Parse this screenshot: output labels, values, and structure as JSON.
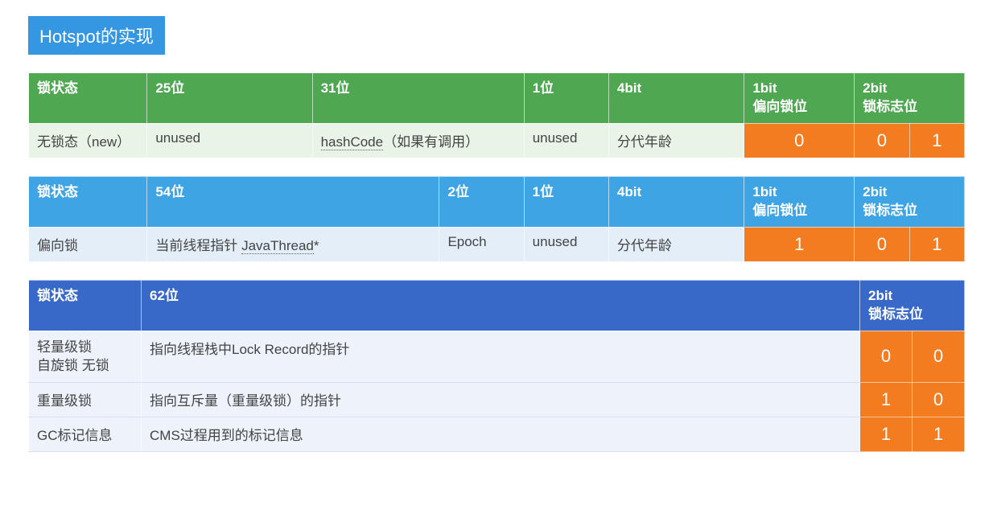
{
  "title": "Hotspot的实现",
  "table1": {
    "headers": {
      "c0": "锁状态",
      "c1": "25位",
      "c2": "31位",
      "c3": "1位",
      "c4": "4bit",
      "c5a": "1bit",
      "c5b": "偏向锁位",
      "c6a": "2bit",
      "c6b": "锁标志位"
    },
    "row": {
      "state": "无锁态（new）",
      "c1": "unused",
      "c2a": "hashCode",
      "c2b": "（如果有调用）",
      "c3": "unused",
      "c4": "分代年龄",
      "bias": "0",
      "flag1": "0",
      "flag2": "1"
    }
  },
  "table2": {
    "headers": {
      "c0": "锁状态",
      "c1": "54位",
      "c2": "2位",
      "c3": "1位",
      "c4": "4bit",
      "c5a": "1bit",
      "c5b": "偏向锁位",
      "c6a": "2bit",
      "c6b": "锁标志位"
    },
    "row": {
      "state": "偏向锁",
      "c1a": "当前线程指针 ",
      "c1b": "JavaThread",
      "c1c": "*",
      "c2": "Epoch",
      "c3": "unused",
      "c4": "分代年龄",
      "bias": "1",
      "flag1": "0",
      "flag2": "1"
    }
  },
  "table3": {
    "headers": {
      "c0": "锁状态",
      "c1": "62位",
      "c2a": "2bit",
      "c2b": "锁标志位"
    },
    "rows": [
      {
        "state_l1": "轻量级锁",
        "state_l2": "自旋锁 无锁",
        "desc": "指向线程栈中Lock Record的指针",
        "flag1": "0",
        "flag2": "0"
      },
      {
        "state_l1": "重量级锁",
        "state_l2": "",
        "desc": "指向互斥量（重量级锁）的指针",
        "flag1": "1",
        "flag2": "0"
      },
      {
        "state_l1": "GC标记信息",
        "state_l2": "",
        "desc": "CMS过程用到的标记信息",
        "flag1": "1",
        "flag2": "1"
      }
    ]
  }
}
